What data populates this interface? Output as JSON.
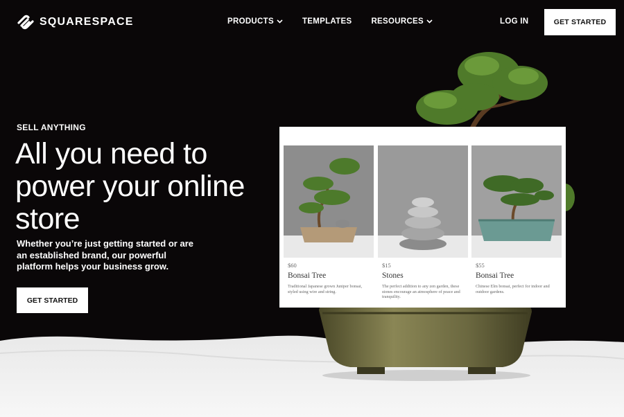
{
  "brand": {
    "name": "SQUARESPACE",
    "logo_icon": "squarespace-logo-icon"
  },
  "nav": {
    "items": [
      {
        "label": "PRODUCTS",
        "has_dropdown": true
      },
      {
        "label": "TEMPLATES",
        "has_dropdown": false
      },
      {
        "label": "RESOURCES",
        "has_dropdown": true
      }
    ],
    "login_label": "LOG IN",
    "cta_label": "GET STARTED"
  },
  "hero": {
    "eyebrow": "SELL ANYTHING",
    "headline": "All you need to power your online store",
    "subcopy": "Whether you’re just getting started or are an established brand, our powerful platform helps your business grow.",
    "cta_label": "GET STARTED"
  },
  "products": [
    {
      "price": "$60",
      "name": "Bonsai Tree",
      "description": "Traditional Japanese grown Juniper bonsai, styled using wire and string."
    },
    {
      "price": "$15",
      "name": "Stones",
      "description": "The perfect addition to any zen garden, these stones encourage an atmosphere of peace and tranquility."
    },
    {
      "price": "$55",
      "name": "Bonsai Tree",
      "description": "Chinese Elm bonsai, perfect for indoor and outdoor gardens."
    }
  ],
  "colors": {
    "background": "#0a0708",
    "text": "#ffffff",
    "button_bg": "#ffffff",
    "button_text": "#111111",
    "foliage": "#4f7a2a",
    "pot": "#6b6840"
  }
}
